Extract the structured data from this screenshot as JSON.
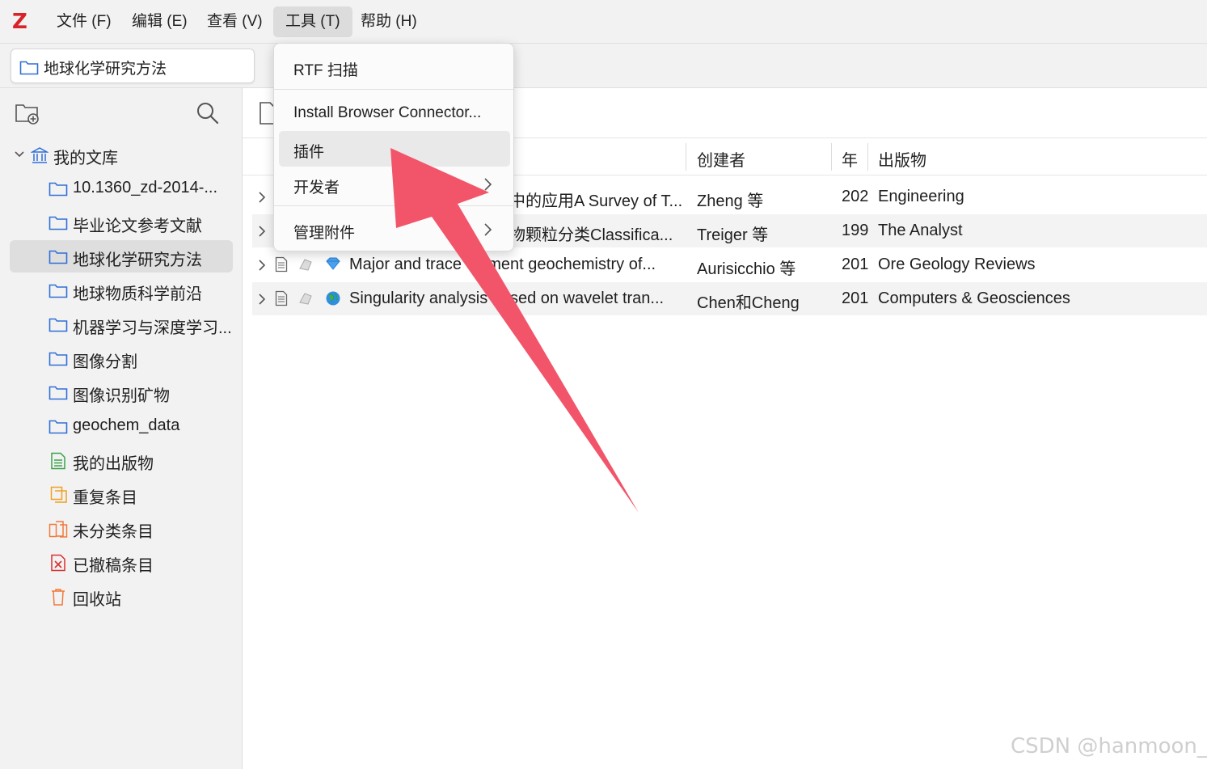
{
  "app": {
    "logo_letter": "Z"
  },
  "menubar": {
    "items": [
      {
        "label": "文件 (F)"
      },
      {
        "label": "编辑 (E)"
      },
      {
        "label": "查看 (V)"
      },
      {
        "label": "工具 (T)"
      },
      {
        "label": "帮助 (H)"
      }
    ],
    "active_index": 3
  },
  "tab": {
    "title": "地球化学研究方法"
  },
  "sidebar": {
    "root": {
      "label": "我的文库"
    },
    "items": [
      {
        "label": "10.1360_zd-2014-...",
        "icon": "folder-icon"
      },
      {
        "label": "毕业论文参考文献",
        "icon": "folder-icon"
      },
      {
        "label": "地球化学研究方法",
        "icon": "folder-icon",
        "selected": true
      },
      {
        "label": "地球物质科学前沿",
        "icon": "folder-icon"
      },
      {
        "label": "机器学习与深度学习...",
        "icon": "folder-icon"
      },
      {
        "label": "图像分割",
        "icon": "folder-icon"
      },
      {
        "label": "图像识别矿物",
        "icon": "folder-icon"
      },
      {
        "label": "geochem_data",
        "icon": "folder-icon"
      },
      {
        "label": "我的出版物",
        "icon": "publications-icon"
      },
      {
        "label": "重复条目",
        "icon": "duplicate-icon"
      },
      {
        "label": "未分类条目",
        "icon": "unfiled-icon"
      },
      {
        "label": "已撤稿条目",
        "icon": "retracted-icon"
      },
      {
        "label": "回收站",
        "icon": "trash-icon"
      }
    ]
  },
  "columns": {
    "creator": "创建者",
    "year": "年",
    "publication": "出版物"
  },
  "items": [
    {
      "title": "中的应用A Survey of T...",
      "creator": "Zheng 等",
      "year": "202",
      "publication": "Engineering"
    },
    {
      "title": "物颗粒分类Classifica...",
      "creator": "Treiger 等",
      "year": "199",
      "publication": "The Analyst"
    },
    {
      "title": "Major and trace element geochemistry of...",
      "creator": "Aurisicchio 等",
      "year": "201",
      "publication": "Ore Geology Reviews"
    },
    {
      "title": "Singularity analysis based on wavelet tran...",
      "creator": "Chen和Cheng",
      "year": "201",
      "publication": "Computers & Geosciences"
    }
  ],
  "tools_menu": {
    "items": [
      {
        "label": "RTF 扫描"
      },
      {
        "label": "Install Browser Connector..."
      },
      {
        "label": "插件"
      },
      {
        "label": "开发者"
      },
      {
        "label": "管理附件"
      }
    ]
  },
  "colors": {
    "accent_arrow": "#f2556a",
    "logo": "#d8232a",
    "folder": "#2f6fd6"
  },
  "watermark": "CSDN @hanmoon_"
}
